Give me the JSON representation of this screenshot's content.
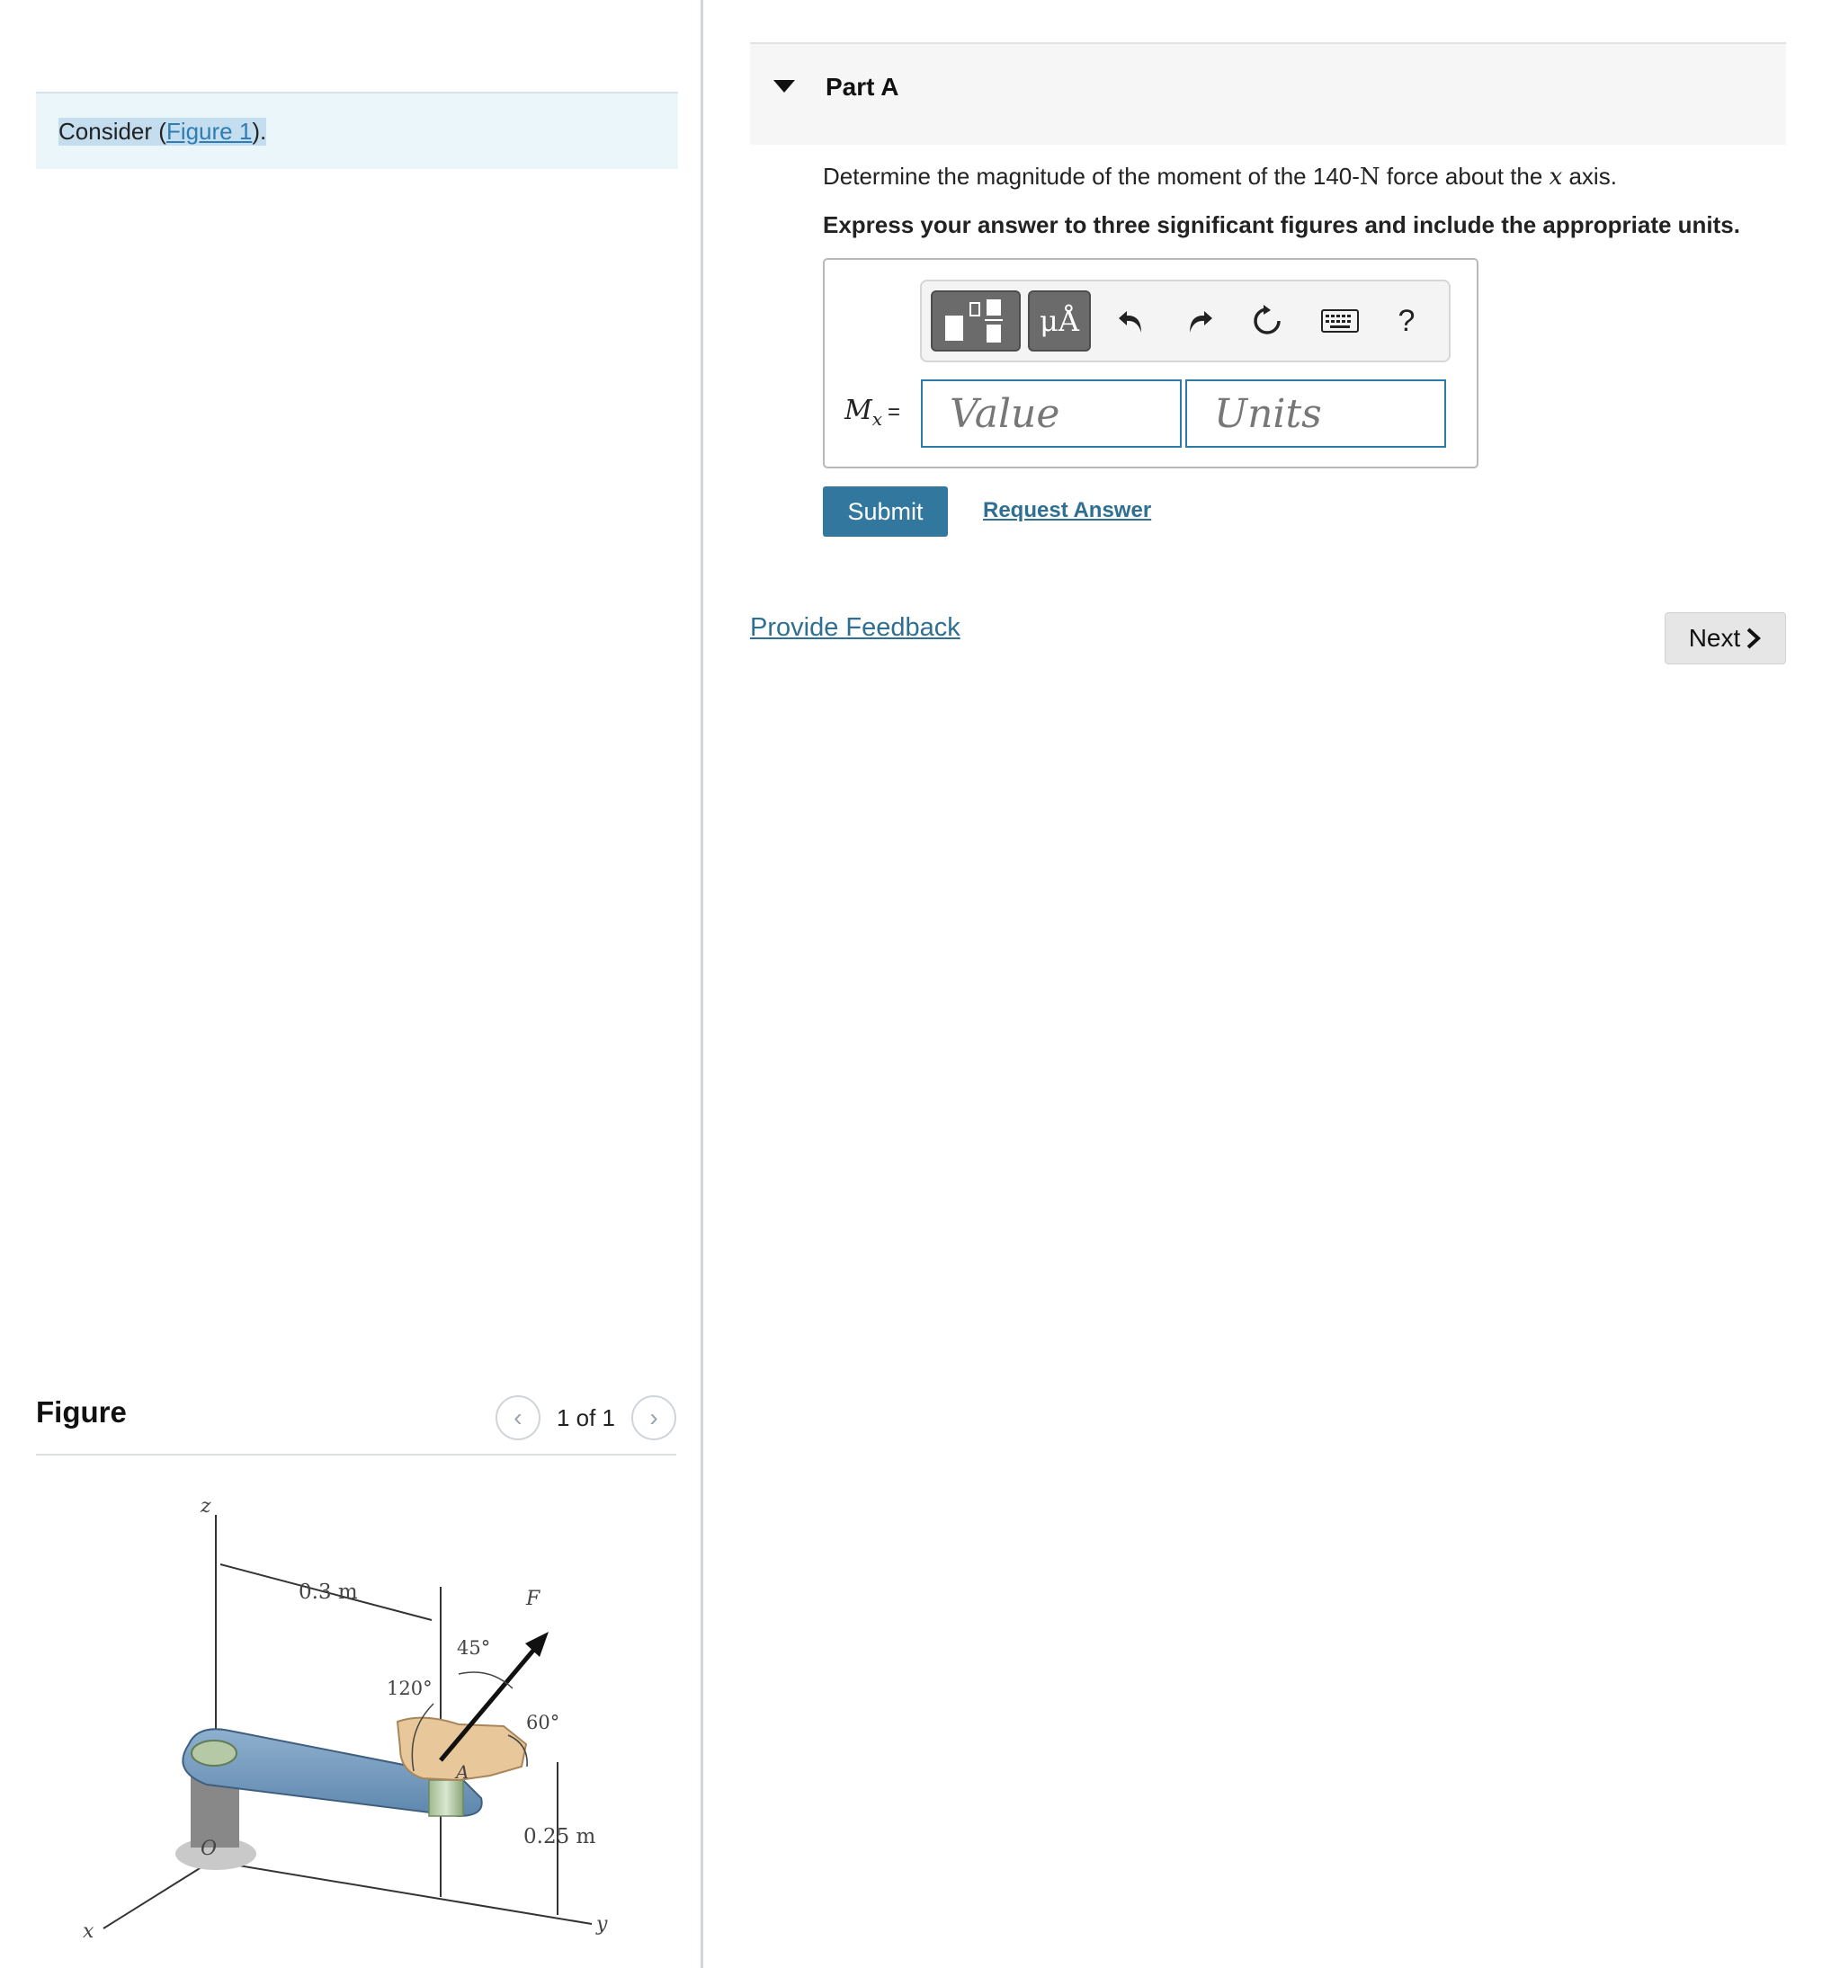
{
  "problem": {
    "consider_prefix": "Consider (",
    "figure_link": "Figure 1",
    "consider_suffix": ")."
  },
  "figure_panel": {
    "title": "Figure",
    "pager": "1 of 1",
    "labels": {
      "z": "z",
      "x": "x",
      "y": "y",
      "o": "O",
      "a": "A",
      "f": "F",
      "dim1": "0.3 m",
      "dim2": "0.25 m",
      "ang1": "45°",
      "ang2": "120°",
      "ang3": "60°"
    }
  },
  "part": {
    "title": "Part A",
    "question_prefix": "Determine the magnitude of the moment of the 140-",
    "question_unit": "N",
    "question_middle": " force about the ",
    "question_axis": "x",
    "question_suffix": " axis.",
    "instruction": "Express your answer to three significant figures and include the appropriate units."
  },
  "answer": {
    "label_main": "M",
    "label_sub": "x",
    "label_eq": "=",
    "value_placeholder": "Value",
    "units_placeholder": "Units",
    "toolbar": {
      "mu_label": "μÅ",
      "help_label": "?"
    }
  },
  "actions": {
    "submit": "Submit",
    "request": "Request Answer",
    "feedback": "Provide Feedback",
    "next": "Next"
  }
}
